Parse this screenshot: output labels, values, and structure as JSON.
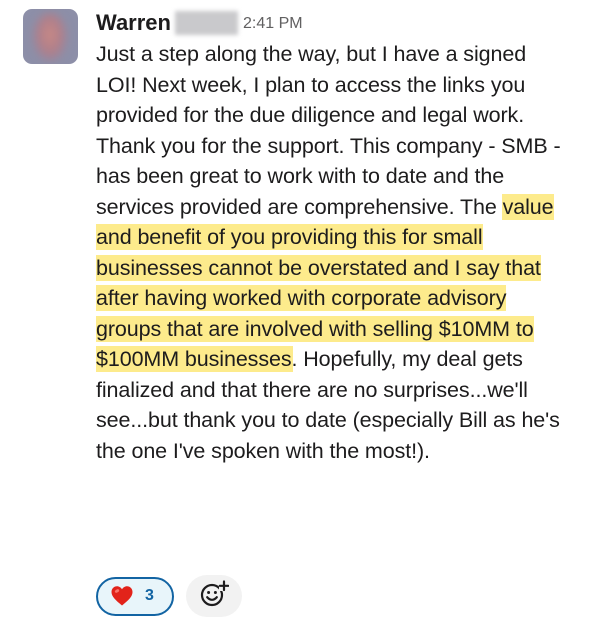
{
  "message": {
    "author": "Warren",
    "timestamp": "2:41 PM",
    "body": {
      "before": "Just a step along the way, but I have a signed LOI! Next week, I plan to access the links you provided for the due diligence and legal work. Thank you for the support. This company - SMB - has been great to work with to date and the services provided are comprehensive. The ",
      "highlighted": "value and benefit of you providing this for small businesses cannot be overstated and I say that after having worked with corporate advisory groups that are involved with selling $10MM to $100MM businesses",
      "after": ". Hopefully, my deal gets finalized and that there are no surprises...we'll see...but thank you to date (especially Bill as he's the one I've spoken with the most!)."
    },
    "highlight_color": "#fdeb8c"
  },
  "reactions": [
    {
      "icon": "heart-icon",
      "count": "3"
    }
  ],
  "colors": {
    "accent": "#1264a3",
    "text": "#1d1c1d",
    "muted": "#616061"
  }
}
